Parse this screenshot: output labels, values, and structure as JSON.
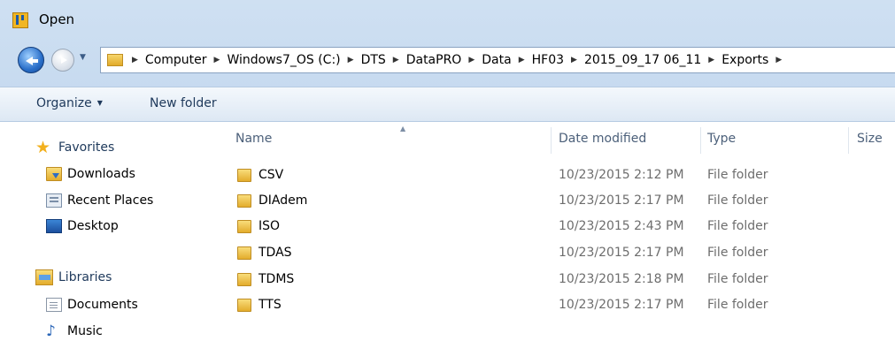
{
  "window": {
    "title": "Open"
  },
  "address": {
    "crumbs": [
      "Computer",
      "Windows7_OS (C:)",
      "DTS",
      "DataPRO",
      "Data",
      "HF03",
      "2015_09_17 06_11",
      "Exports"
    ]
  },
  "toolbar": {
    "organize_label": "Organize",
    "new_folder_label": "New folder"
  },
  "nav": {
    "favorites_label": "Favorites",
    "favorites_items": [
      "Downloads",
      "Recent Places",
      "Desktop"
    ],
    "libraries_label": "Libraries",
    "libraries_items": [
      "Documents",
      "Music"
    ]
  },
  "columns": {
    "name": "Name",
    "date_modified": "Date modified",
    "type": "Type",
    "size": "Size"
  },
  "files": [
    {
      "name": "CSV",
      "date": "10/23/2015 2:12 PM",
      "type": "File folder"
    },
    {
      "name": "DIAdem",
      "date": "10/23/2015 2:17 PM",
      "type": "File folder"
    },
    {
      "name": "ISO",
      "date": "10/23/2015 2:43 PM",
      "type": "File folder"
    },
    {
      "name": "TDAS",
      "date": "10/23/2015 2:17 PM",
      "type": "File folder"
    },
    {
      "name": "TDMS",
      "date": "10/23/2015 2:18 PM",
      "type": "File folder"
    },
    {
      "name": "TTS",
      "date": "10/23/2015 2:17 PM",
      "type": "File folder"
    }
  ],
  "icons": {
    "app": "open-dialog-icon",
    "back": "back-arrow-icon",
    "forward": "forward-arrow-icon",
    "folder": "folder-icon",
    "favorites": "star-icon",
    "music": "music-note-icon"
  },
  "colors": {
    "frame": "#bcd3ec",
    "text_primary": "#1e395b",
    "folder": "#e3ac2c",
    "muted_text": "#6d6d6d"
  }
}
